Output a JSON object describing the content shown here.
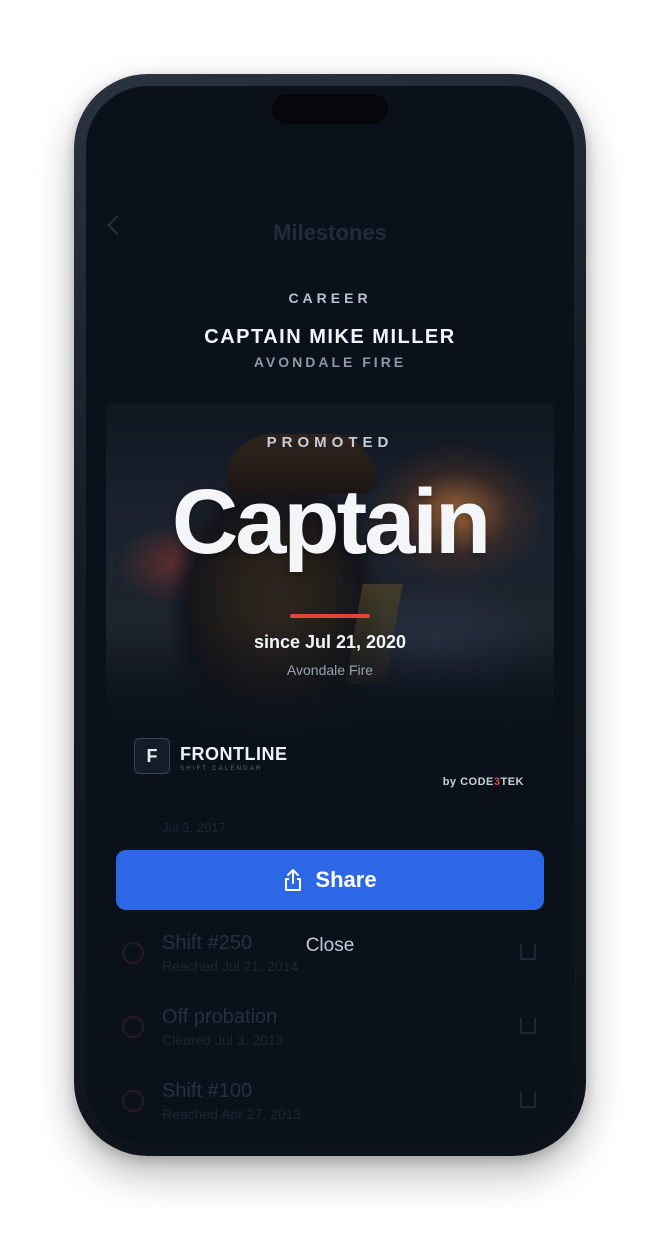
{
  "nav": {
    "title": "Milestones"
  },
  "card": {
    "category": "CAREER",
    "person": "CAPTAIN MIKE MILLER",
    "department": "AVONDALE FIRE",
    "event": "PROMOTED",
    "rank": "Captain",
    "since": "since Jul 21, 2020",
    "since_org": "Avondale Fire",
    "brand": {
      "letter": "F",
      "name": "FRONTLINE",
      "tagline": "SHIFT CALENDAR"
    },
    "byline": {
      "prefix": "by CODE",
      "accent": "3",
      "suffix": "TEK"
    },
    "accent_color": "#e0453a"
  },
  "background_list": {
    "peek_date": "Jul 3, 2017",
    "items": [
      {
        "title": "Shift #250",
        "subtitle": "Reached Jul 21, 2014"
      },
      {
        "title": "Off probation",
        "subtitle": "Cleared Jul 3, 2013"
      },
      {
        "title": "Shift #100",
        "subtitle": "Reached Apr 27, 2013"
      }
    ]
  },
  "actions": {
    "share_label": "Share",
    "close_label": "Close",
    "share_color": "#2c67e6"
  }
}
